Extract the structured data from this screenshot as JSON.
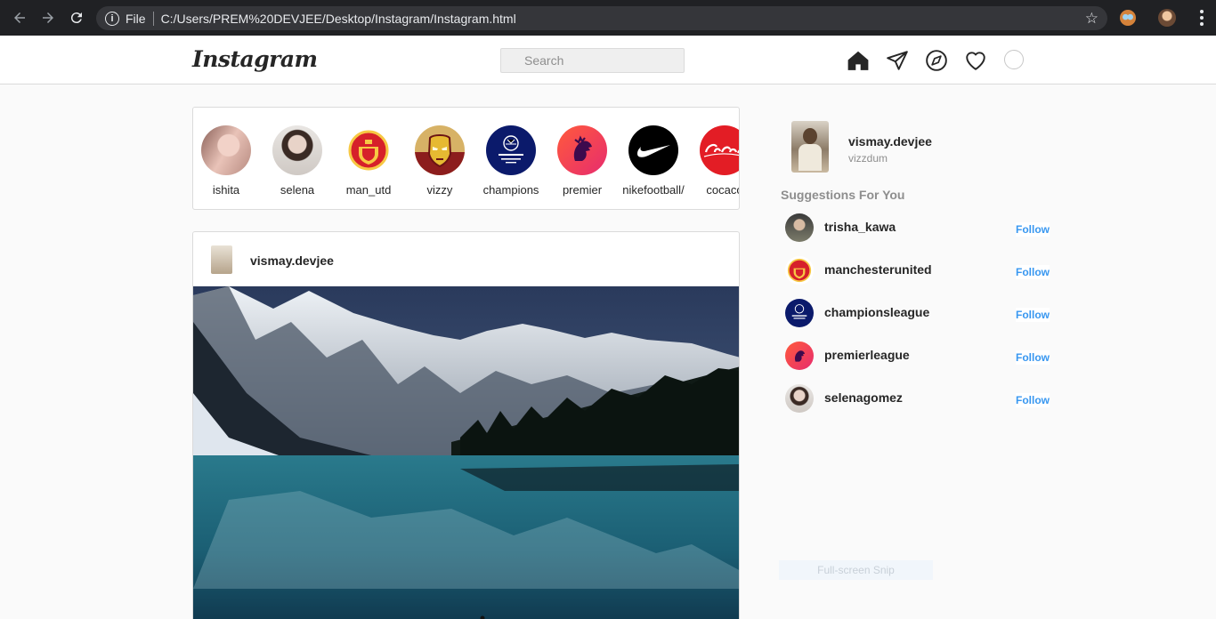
{
  "browser": {
    "file_label": "File",
    "url": "C:/Users/PREM%20DEVJEE/Desktop/Instagram/Instagram.html"
  },
  "header": {
    "logo": "Instagram",
    "search_placeholder": "Search",
    "icons": [
      "home-icon",
      "direct-message-icon",
      "explore-icon",
      "heart-icon",
      "profile-icon"
    ]
  },
  "stories": [
    {
      "label": "ishita",
      "icon": "avatar-photo"
    },
    {
      "label": "selena",
      "icon": "avatar-photo"
    },
    {
      "label": "man_utd",
      "icon": "manchester-united-crest"
    },
    {
      "label": "vizzy",
      "icon": "iron-man-mask"
    },
    {
      "label": "champions",
      "icon": "champions-league-logo"
    },
    {
      "label": "premier",
      "icon": "premier-league-lion"
    },
    {
      "label": "nikefootball/",
      "icon": "nike-swoosh"
    },
    {
      "label": "cocaco",
      "icon": "coca-cola-logo"
    }
  ],
  "post": {
    "username": "vismay.devjee"
  },
  "sidebar": {
    "username": "vismay.devjee",
    "subtitle": "vizzdum",
    "suggestions_title": "Suggestions For You",
    "follow_label": "Follow",
    "suggestions": [
      {
        "name": "trisha_kawa"
      },
      {
        "name": "manchesterunited"
      },
      {
        "name": "championsleague"
      },
      {
        "name": "premierleague"
      },
      {
        "name": "selenagomez"
      }
    ]
  },
  "overlay": {
    "snip_label": "Full-screen Snip"
  },
  "colors": {
    "link": "#3897f0",
    "chrome": "#202124",
    "border": "#dbdbdb"
  }
}
